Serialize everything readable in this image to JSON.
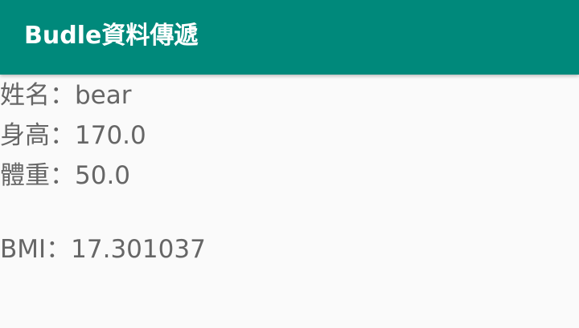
{
  "app_bar": {
    "title": "Budle資料傳遞",
    "color": "#00897b"
  },
  "info": {
    "name_line": "姓名：bear",
    "height_line": "身高：170.0",
    "weight_line": "體重：50.0",
    "bmi_line": "BMI：17.301037"
  }
}
